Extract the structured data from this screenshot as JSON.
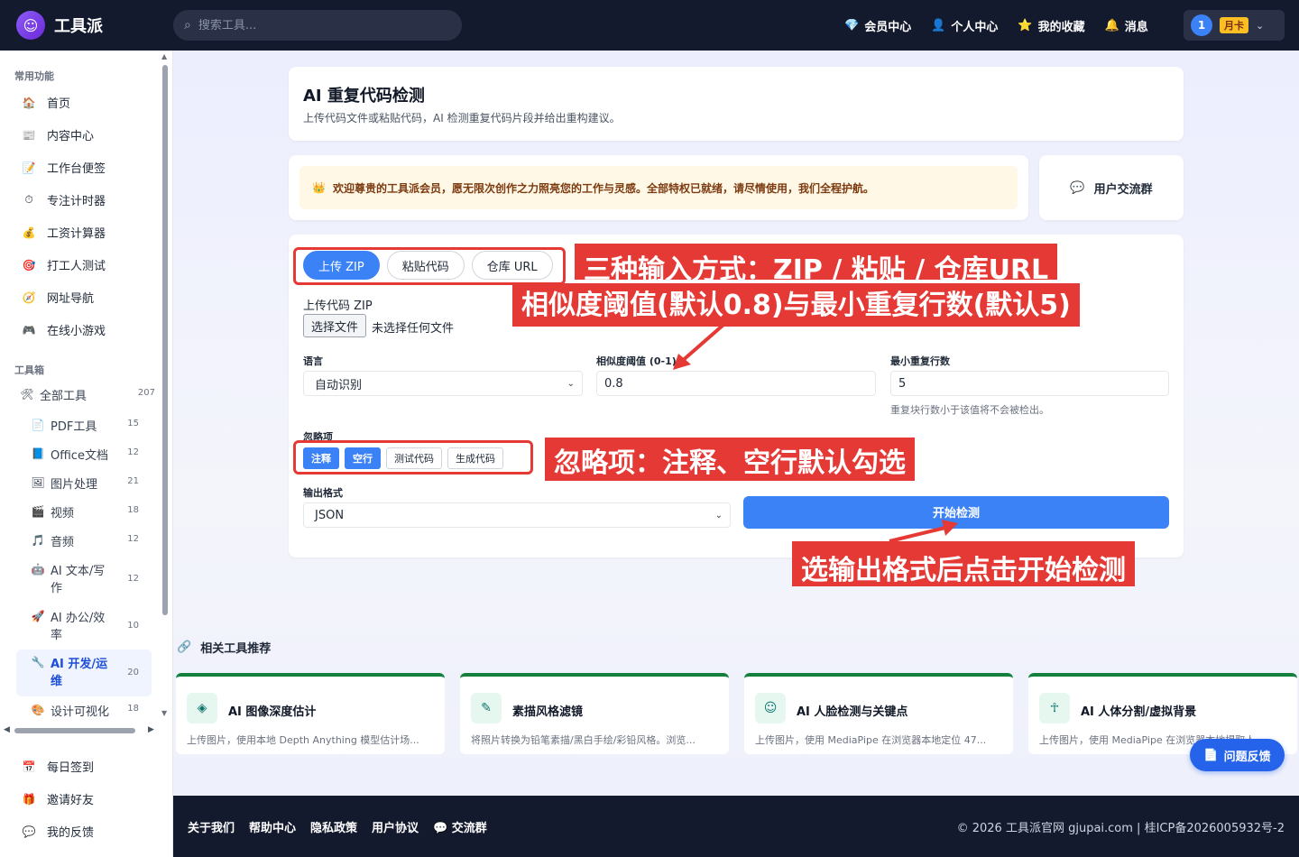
{
  "header": {
    "logo_text": "工具派",
    "search_placeholder": "搜索工具...",
    "nav": [
      {
        "icon": "gem-icon",
        "glyph": "💎",
        "label": "会员中心"
      },
      {
        "icon": "person-icon",
        "glyph": "👤",
        "label": "个人中心"
      },
      {
        "icon": "star-icon",
        "glyph": "⭐",
        "label": "我的收藏"
      },
      {
        "icon": "bell-icon",
        "glyph": "🔔",
        "label": "消息"
      }
    ],
    "user_badge": "1",
    "user_plan": "月卡"
  },
  "sidebar": {
    "common_title": "常用功能",
    "common": [
      {
        "icon": "home-icon",
        "glyph": "🏠",
        "label": "首页"
      },
      {
        "icon": "newspaper-icon",
        "glyph": "📰",
        "label": "内容中心"
      },
      {
        "icon": "memo-icon",
        "glyph": "📝",
        "label": "工作台便签"
      },
      {
        "icon": "timer-icon",
        "glyph": "⏱",
        "label": "专注计时器"
      },
      {
        "icon": "money-bag-icon",
        "glyph": "💰",
        "label": "工资计算器"
      },
      {
        "icon": "target-icon",
        "glyph": "🎯",
        "label": "打工人测试"
      },
      {
        "icon": "compass-icon",
        "glyph": "🧭",
        "label": "网址导航"
      },
      {
        "icon": "gamepad-icon",
        "glyph": "🎮",
        "label": "在线小游戏"
      }
    ],
    "toolbox_title": "工具箱",
    "all_tools": {
      "icon": "hammer-icon",
      "glyph": "🛠",
      "label": "全部工具",
      "count": "207"
    },
    "tools": [
      {
        "icon": "pdf-icon",
        "glyph": "📄",
        "label": "PDF工具",
        "count": "15"
      },
      {
        "icon": "office-icon",
        "glyph": "📘",
        "label": "Office文档",
        "count": "12"
      },
      {
        "icon": "image-icon",
        "glyph": "🖼",
        "label": "图片处理",
        "count": "21"
      },
      {
        "icon": "video-icon",
        "glyph": "🎬",
        "label": "视频",
        "count": "18"
      },
      {
        "icon": "music-icon",
        "glyph": "🎵",
        "label": "音频",
        "count": "12"
      },
      {
        "icon": "ai-write-icon",
        "glyph": "🤖",
        "label": "AI 文本/写作",
        "count": "12"
      },
      {
        "icon": "rocket-icon",
        "glyph": "🚀",
        "label": "AI 办公/效率",
        "count": "10"
      },
      {
        "icon": "dev-icon",
        "glyph": "🔧",
        "label": "AI 开发/运维",
        "count": "20"
      },
      {
        "icon": "palette-icon",
        "glyph": "🎨",
        "label": "设计可视化",
        "count": "18"
      }
    ],
    "bottom": [
      {
        "icon": "calendar-icon",
        "glyph": "📅",
        "label": "每日签到"
      },
      {
        "icon": "gift-icon",
        "glyph": "🎁",
        "label": "邀请好友"
      },
      {
        "icon": "speech-bubble-icon",
        "glyph": "💬",
        "label": "我的反馈"
      }
    ]
  },
  "page": {
    "title": "AI 重复代码检测",
    "subtitle": "上传代码文件或粘贴代码，AI 检测重复代码片段并给出重构建议。",
    "notice": "欢迎尊贵的工具派会员，愿无限次创作之力照亮您的工作与灵感。全部特权已就绪，请尽情使用，我们全程护航。",
    "group_label": "用户交流群"
  },
  "form": {
    "tabs": [
      "上传 ZIP",
      "粘贴代码",
      "仓库 URL"
    ],
    "upload_label": "上传代码 ZIP",
    "file_button": "选择文件",
    "file_status": "未选择任何文件",
    "language_label": "语言",
    "language_value": "自动识别",
    "threshold_label": "相似度阈值 (0-1)",
    "threshold_value": "0.8",
    "min_lines_label": "最小重复行数",
    "min_lines_value": "5",
    "min_lines_hint": "重复块行数小于该值将不会被检出。",
    "ignore_label": "忽略项",
    "ignore_options": [
      {
        "label": "注释",
        "checked": true
      },
      {
        "label": "空行",
        "checked": true
      },
      {
        "label": "测试代码",
        "checked": false
      },
      {
        "label": "生成代码",
        "checked": false
      }
    ],
    "output_label": "输出格式",
    "output_value": "JSON",
    "start_button": "开始检测"
  },
  "annotations": [
    "三种输入方式：ZIP / 粘贴 / 仓库URL",
    "相似度阈值(默认0.8)与最小重复行数(默认5)",
    "忽略项：注释、空行默认勾选",
    "选输出格式后点击开始检测"
  ],
  "related": {
    "title": "相关工具推荐",
    "items": [
      {
        "icon": "layers-icon",
        "glyph": "◈",
        "name": "AI 图像深度估计",
        "desc": "上传图片，使用本地 Depth Anything 模型估计场..."
      },
      {
        "icon": "sketch-icon",
        "glyph": "✎",
        "name": "素描风格滤镜",
        "desc": "将照片转换为铅笔素描/黑白手绘/彩铅风格。浏览..."
      },
      {
        "icon": "face-icon",
        "glyph": "☺",
        "name": "AI 人脸检测与关键点",
        "desc": "上传图片，使用 MediaPipe 在浏览器本地定位 47..."
      },
      {
        "icon": "body-icon",
        "glyph": "☥",
        "name": "AI 人体分割/虚拟背景",
        "desc": "上传图片，使用 MediaPipe 在浏览器本地提取人..."
      }
    ]
  },
  "footer": {
    "links": [
      "关于我们",
      "帮助中心",
      "隐私政策",
      "用户协议",
      "交流群"
    ],
    "copyright": "© 2026 工具派官网 gjupai.com | 桂ICP备2026005932号-2"
  },
  "feedback_button": "问题反馈",
  "colors": {
    "primary": "#3b82f6",
    "header_bg": "#141a2e",
    "annotation": "#e53935",
    "card_accent": "#15803d"
  }
}
